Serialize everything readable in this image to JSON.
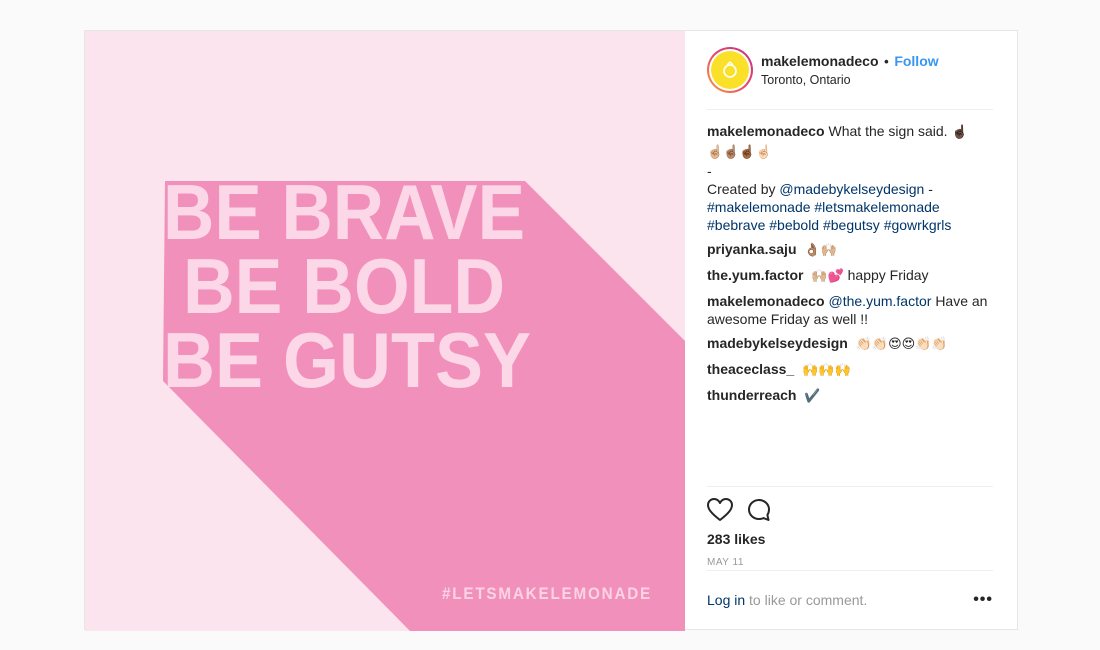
{
  "post_image": {
    "lines": [
      "BE BRAVE",
      "BE BOLD",
      "BE GUTSY"
    ],
    "hashtag": "#LETSMAKELEMONADE",
    "colors": {
      "background": "#fce4ee",
      "shadow": "#f290bc",
      "letters": "#fcd7e7",
      "hashtag": "#fbd3e4"
    }
  },
  "header": {
    "username": "makelemonadeco",
    "separator": "•",
    "follow_label": "Follow",
    "location": "Toronto, Ontario",
    "avatar_icon": "lemon-logo-icon"
  },
  "caption": {
    "user": "makelemonadeco",
    "text": "What the sign said.",
    "emoji_line1": "☝🏿",
    "emoji_line2": "☝🏼☝🏽☝🏾☝🏻",
    "dash": "-",
    "created_by": "Created by",
    "mention": "@madebykelseydesign",
    "after_mention": " -",
    "hashtags_line1": "#makelemonade #letsmakelemonade",
    "hashtags_line2": "#bebrave #bebold #begutsy #gowrkgrls"
  },
  "comments": [
    {
      "user": "priyanka.saju",
      "text": "👌🏽🙌🏼"
    },
    {
      "user": "the.yum.factor",
      "emoji": "🙌🏼💕",
      "text": "happy Friday"
    },
    {
      "user": "makelemonadeco",
      "mention": "@the.yum.factor",
      "text": "Have an awesome Friday as well !!"
    },
    {
      "user": "madebykelseydesign",
      "text": "👏🏻👏🏻😍😍👏🏻👏🏻"
    },
    {
      "user": "theaceclass_",
      "text": "🙌🙌🙌"
    },
    {
      "user": "thunderreach",
      "text": "✔️"
    }
  ],
  "actions": {
    "like_icon": "heart-icon",
    "comment_icon": "comment-bubble-icon",
    "likes": "283 likes",
    "date": "MAY 11"
  },
  "footer": {
    "login_link": "Log in",
    "login_rest": " to like or comment.",
    "more_label": "•••"
  }
}
